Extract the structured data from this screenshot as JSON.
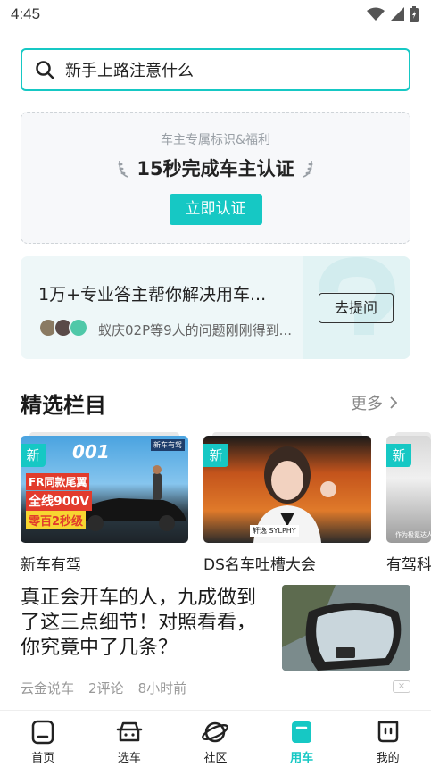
{
  "status_bar": {
    "time": "4:45"
  },
  "search": {
    "text": "新手上路注意什么"
  },
  "certification": {
    "subtitle": "车主专属标识&福利",
    "title": "15秒完成车主认证",
    "button": "立即认证"
  },
  "qa": {
    "title": "1万+专业答主帮你解决用车...",
    "description": "蚁庆02P等9人的问题刚刚得到...",
    "button": "去提问"
  },
  "featured": {
    "title": "精选栏目",
    "more": "更多",
    "items": [
      {
        "badge": "新",
        "label": "新车有驾",
        "thumb_text": [
          "FR同款尾翼",
          "全线900V",
          "零百2秒级"
        ],
        "thumb_top": "001",
        "thumb_tag": "新车有驾"
      },
      {
        "badge": "新",
        "label": "DS名车吐槽大会",
        "thumb_tag": "轩逸 SYLPHY"
      },
      {
        "badge": "新",
        "label": "有驾科",
        "thumb_tag": "作为极氪达人"
      }
    ]
  },
  "article": {
    "title": "真正会开车的人，九成做到了这三点细节！对照看看，你究竟中了几条？",
    "author": "云金说车",
    "comments": "2评论",
    "time": "8小时前",
    "close": "×"
  },
  "tabs": [
    {
      "label": "首页",
      "icon": "home-icon",
      "active": false
    },
    {
      "label": "选车",
      "icon": "car-icon",
      "active": false
    },
    {
      "label": "社区",
      "icon": "planet-icon",
      "active": false
    },
    {
      "label": "用车",
      "icon": "car-use-icon",
      "active": true
    },
    {
      "label": "我的",
      "icon": "profile-icon",
      "active": false
    }
  ],
  "colors": {
    "accent": "#16c8c4",
    "card_bg": "#eef7f8"
  }
}
